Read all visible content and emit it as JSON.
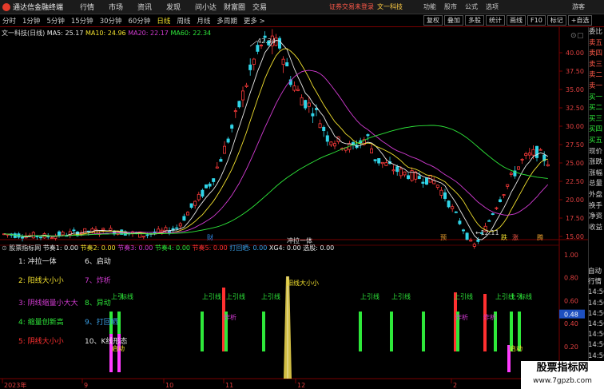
{
  "menubar": {
    "app": "通达信金融终端",
    "items": [
      "行情",
      "市场",
      "资讯",
      "发现",
      "问小达",
      "财富圈",
      "交易"
    ],
    "notice": "证券交易未登录",
    "stock_link": "文一科技",
    "right": [
      "功能",
      "股市",
      "公式",
      "选项"
    ],
    "guest": "游客"
  },
  "toolbar": {
    "periods": [
      "分时",
      "1分钟",
      "5分钟",
      "15分钟",
      "30分钟",
      "60分钟",
      "日线",
      "周线",
      "月线",
      "多周期",
      "更多 >"
    ],
    "selected": "日线",
    "right_buttons": [
      "复权",
      "叠加",
      "多股",
      "统计",
      "画线",
      "F10",
      "标记",
      "+自选"
    ]
  },
  "ma_legend": {
    "stock": "文一科技(日线)",
    "items": [
      {
        "label": "MA5: 25.17",
        "color": "#e8e8e8"
      },
      {
        "label": "MA10: 24.96",
        "color": "#f2e02e"
      },
      {
        "label": "MA20: 22.17",
        "color": "#d23bd2"
      },
      {
        "label": "MA60: 22.34",
        "color": "#2ee83a"
      }
    ]
  },
  "indicator_legend": {
    "name": "股票指标网",
    "items": [
      {
        "label": "节奏1: 0.00",
        "color": "#e8e8e8"
      },
      {
        "label": "节奏2: 0.00",
        "color": "#f2e02e"
      },
      {
        "label": "节奏3: 0.00",
        "color": "#d23bd2"
      },
      {
        "label": "节奏4: 0.00",
        "color": "#2ee83a"
      },
      {
        "label": "节奏5: 0.00",
        "color": "#ff3030"
      },
      {
        "label": "打回晒: 0.00",
        "color": "#3aa0e8"
      },
      {
        "label": "XG4: 0.00",
        "color": "#e8e8e8"
      },
      {
        "label": "选股: 0.00",
        "color": "#e8e8e8"
      }
    ]
  },
  "price_axis": [
    "40.00",
    "37.50",
    "35.00",
    "32.50",
    "30.00",
    "27.50",
    "25.00",
    "22.50",
    "20.00",
    "17.50",
    "15.00"
  ],
  "ind_axis": [
    "1.00",
    "0.80",
    "0.60",
    "0.48",
    "0.40",
    "0.20"
  ],
  "date_axis": [
    "2023年",
    "9",
    "10",
    "11",
    "12",
    "2",
    "3"
  ],
  "annotations": {
    "high": "42.34",
    "low": "←12.11",
    "markers": [
      {
        "text": "财",
        "color": "#2e8ae8"
      },
      {
        "text": "预",
        "color": "#e8a02e"
      },
      {
        "text": "跌",
        "color": "#f2e02e"
      },
      {
        "text": "涨",
        "color": "#ff5a4a"
      },
      {
        "text": "腾",
        "color": "#e8a02e"
      }
    ]
  },
  "conditions": [
    {
      "text": "1: 冲拉一体",
      "color": "#e8e8e8"
    },
    {
      "text": "6、启动",
      "color": "#e8e8e8"
    },
    {
      "text": "2: 阳线大小小",
      "color": "#f2e02e"
    },
    {
      "text": "7、炸析",
      "color": "#d23bd2"
    },
    {
      "text": "3: 阴线缩量小大大",
      "color": "#d23bd2"
    },
    {
      "text": "8、异动",
      "color": "#2ee83a"
    },
    {
      "text": "4: 缩量创新高",
      "color": "#2ee83a"
    },
    {
      "text": "9、打回晒",
      "color": "#3aa0e8"
    },
    {
      "text": "5: 阴线大小小",
      "color": "#ff3030"
    },
    {
      "text": "10、K线形态",
      "color": "#e8e8e8"
    }
  ],
  "signal_labels": {
    "up": "上引线",
    "up_mark": "上引",
    "mark_line": "标线",
    "rise": "炸析",
    "start": "启动",
    "spike_top": "冲拉一体",
    "spike_mid": "阳线大小小",
    "yi": "异动"
  },
  "right_panel": {
    "quote": [
      "委比",
      "卖五",
      "卖四",
      "卖三",
      "卖二",
      "卖一",
      "买一",
      "买二",
      "买三",
      "买四",
      "买五",
      "现价",
      "涨跌",
      "涨幅",
      "总量",
      "外盘",
      "换手",
      "净资",
      "收益"
    ],
    "lower": [
      "自动",
      "行情",
      "14:50",
      "14:50",
      "14:50",
      "14:50",
      "14:50",
      "14:50",
      "14:50",
      "14:50",
      "14:50",
      "14:50"
    ]
  },
  "watermark": {
    "line1": "股票指标网",
    "line2": "www.7gpzb.com"
  }
}
